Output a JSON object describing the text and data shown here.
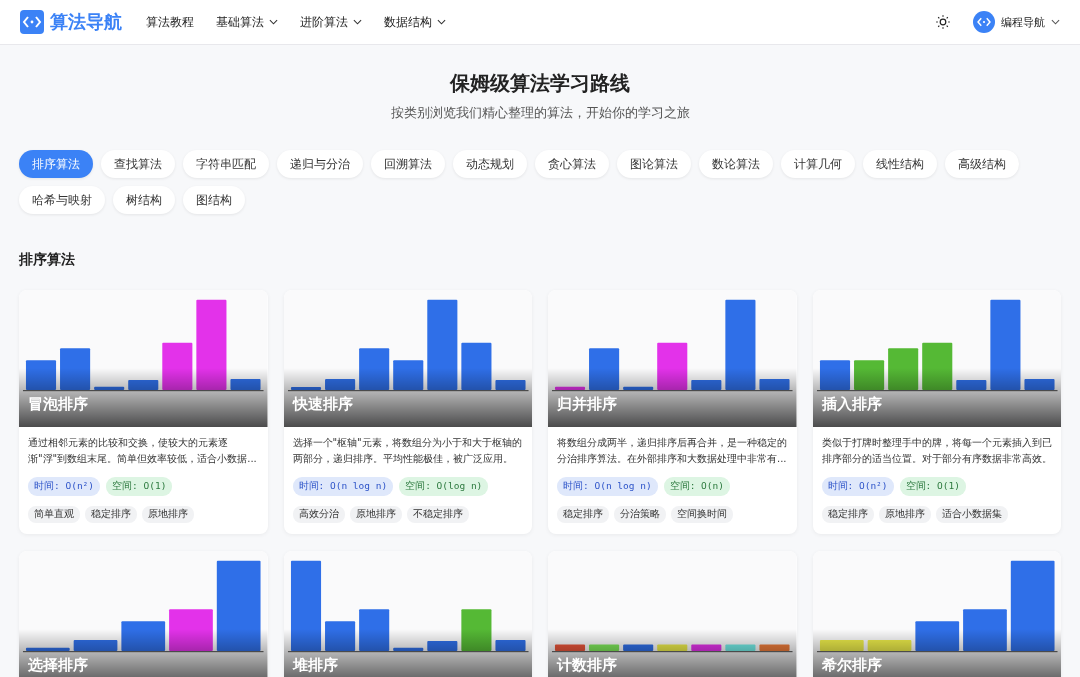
{
  "header": {
    "logo": "算法导航",
    "nav": [
      {
        "label": "算法教程",
        "dropdown": false
      },
      {
        "label": "基础算法",
        "dropdown": true
      },
      {
        "label": "进阶算法",
        "dropdown": true
      },
      {
        "label": "数据结构",
        "dropdown": true
      }
    ],
    "user": {
      "name": "编程导航"
    }
  },
  "hero": {
    "title": "保姆级算法学习路线",
    "subtitle": "按类别浏览我们精心整理的算法，开始你的学习之旅"
  },
  "categories": [
    {
      "label": "排序算法",
      "selected": true
    },
    {
      "label": "查找算法",
      "selected": false
    },
    {
      "label": "字符串匹配",
      "selected": false
    },
    {
      "label": "递归与分治",
      "selected": false
    },
    {
      "label": "回溯算法",
      "selected": false
    },
    {
      "label": "动态规划",
      "selected": false
    },
    {
      "label": "贪心算法",
      "selected": false
    },
    {
      "label": "图论算法",
      "selected": false
    },
    {
      "label": "数论算法",
      "selected": false
    },
    {
      "label": "计算几何",
      "selected": false
    },
    {
      "label": "线性结构",
      "selected": false
    },
    {
      "label": "高级结构",
      "selected": false
    },
    {
      "label": "哈希与映射",
      "selected": false
    },
    {
      "label": "树结构",
      "selected": false
    },
    {
      "label": "图结构",
      "selected": false
    }
  ],
  "section": {
    "title": "排序算法",
    "cards": [
      {
        "title": "冒泡排序",
        "description": "通过相邻元素的比较和交换，使较大的元素逐渐\"浮\"到数组末尾。简单但效率较低，适合小数据...",
        "time": "时间: O(n²)",
        "space": "空间: O(1)",
        "tags": [
          "简单直观",
          "稳定排序",
          "原地排序"
        ]
      },
      {
        "title": "快速排序",
        "description": "选择一个\"枢轴\"元素，将数组分为小于和大于枢轴的两部分，递归排序。平均性能极佳，被广泛应用。",
        "time": "时间: O(n log n)",
        "space": "空间: O(log n)",
        "tags": [
          "高效分治",
          "原地排序",
          "不稳定排序"
        ]
      },
      {
        "title": "归并排序",
        "description": "将数组分成两半，递归排序后再合并，是一种稳定的分治排序算法。在外部排序和大数据处理中非常有...",
        "time": "时间: O(n log n)",
        "space": "空间: O(n)",
        "tags": [
          "稳定排序",
          "分治策略",
          "空间换时间"
        ]
      },
      {
        "title": "插入排序",
        "description": "类似于打牌时整理手中的牌，将每一个元素插入到已排序部分的适当位置。对于部分有序数据非常高效。",
        "time": "时间: O(n²)",
        "space": "空间: O(1)",
        "tags": [
          "稳定排序",
          "原地排序",
          "适合小数据集"
        ]
      },
      {
        "title": "选择排序"
      },
      {
        "title": "堆排序"
      },
      {
        "title": "计数排序"
      },
      {
        "title": "希尔排序"
      }
    ]
  }
}
